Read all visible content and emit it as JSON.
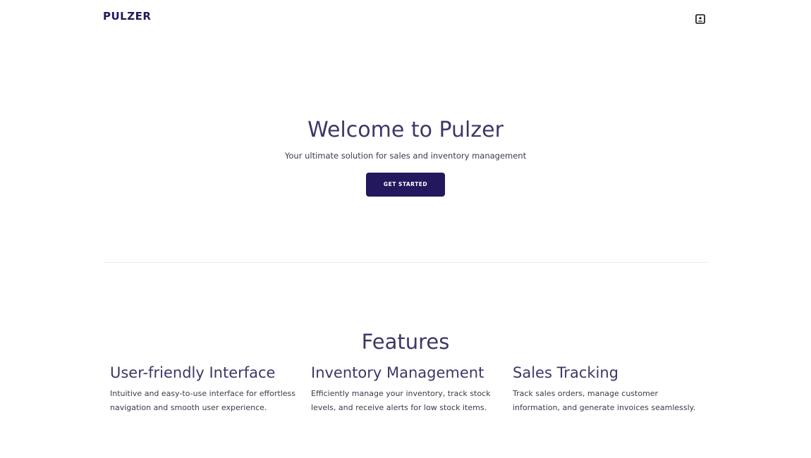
{
  "header": {
    "logo": "PULZER",
    "user_icon": "user-profile-icon"
  },
  "hero": {
    "title": "Welcome to Pulzer",
    "subtitle": "Your ultimate solution for sales and inventory management",
    "cta_label": "GET STARTED"
  },
  "features": {
    "title": "Features",
    "items": [
      {
        "title": "User-friendly Interface",
        "description": "Intuitive and easy-to-use interface for effortless navigation and smooth user experience."
      },
      {
        "title": "Inventory Management",
        "description": "Efficiently manage your inventory, track stock levels, and receive alerts for low stock items."
      },
      {
        "title": "Sales Tracking",
        "description": "Track sales orders, manage customer information, and generate invoices seamlessly."
      }
    ]
  },
  "colors": {
    "brand": "#23185e",
    "heading": "#3d3768",
    "body_text": "#3a3a4a",
    "divider": "#ececf0"
  }
}
